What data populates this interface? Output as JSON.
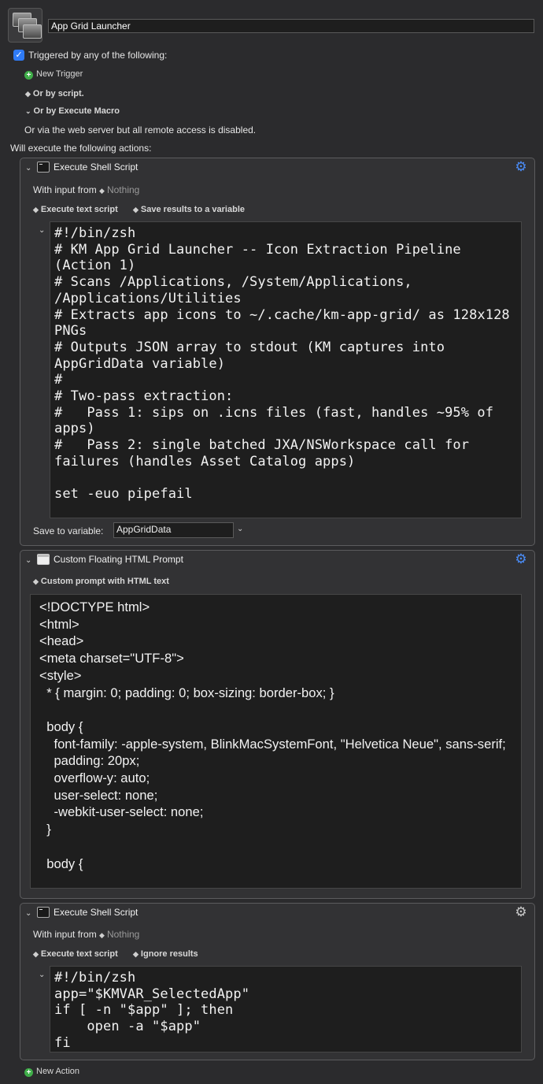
{
  "macro": {
    "name": "App Grid Launcher",
    "icon": "app-grid-icon"
  },
  "triggers": {
    "heading": "Triggered by any of the following:",
    "checked": true,
    "new_trigger": "New Trigger",
    "by_script": "Or by script.",
    "by_execute": "Or by Execute Macro",
    "web_server": "Or via the web server but all remote access is disabled."
  },
  "actions_heading": "Will execute the following actions:",
  "actions": [
    {
      "title": "Execute Shell Script",
      "input_label": "With input from",
      "input_value": "Nothing",
      "mode": "Execute text script",
      "results": "Save results to a variable",
      "code": "#!/bin/zsh\n# KM App Grid Launcher -- Icon Extraction Pipeline (Action 1)\n# Scans /Applications, /System/Applications, /Applications/Utilities\n# Extracts app icons to ~/.cache/km-app-grid/ as 128x128 PNGs\n# Outputs JSON array to stdout (KM captures into AppGridData variable)\n#\n# Two-pass extraction:\n#   Pass 1: sips on .icns files (fast, handles ~95% of apps)\n#   Pass 2: single batched JXA/NSWorkspace call for failures (handles Asset Catalog apps)\n\nset -euo pipefail",
      "save_label": "Save to variable:",
      "save_var": "AppGridData"
    },
    {
      "title": "Custom Floating HTML Prompt",
      "mode": "Custom prompt with HTML text",
      "code": "<!DOCTYPE html>\n<html>\n<head>\n<meta charset=\"UTF-8\">\n<style>\n  * { margin: 0; padding: 0; box-sizing: border-box; }\n\n  body {\n    font-family: -apple-system, BlinkMacSystemFont, \"Helvetica Neue\", sans-serif;\n    padding: 20px;\n    overflow-y: auto;\n    user-select: none;\n    -webkit-user-select: none;\n  }\n\n  body {"
    },
    {
      "title": "Execute Shell Script",
      "input_label": "With input from",
      "input_value": "Nothing",
      "mode": "Execute text script",
      "results": "Ignore results",
      "code": "#!/bin/zsh\napp=\"$KMVAR_SelectedApp\"\nif [ -n \"$app\" ]; then\n    open -a \"$app\"\nfi"
    }
  ],
  "new_action": "New Action",
  "colors": {
    "background": "#2b2b2d",
    "accent": "#2f7bf6",
    "gear_active": "#4a8cf7",
    "add_green": "#3fae49"
  }
}
